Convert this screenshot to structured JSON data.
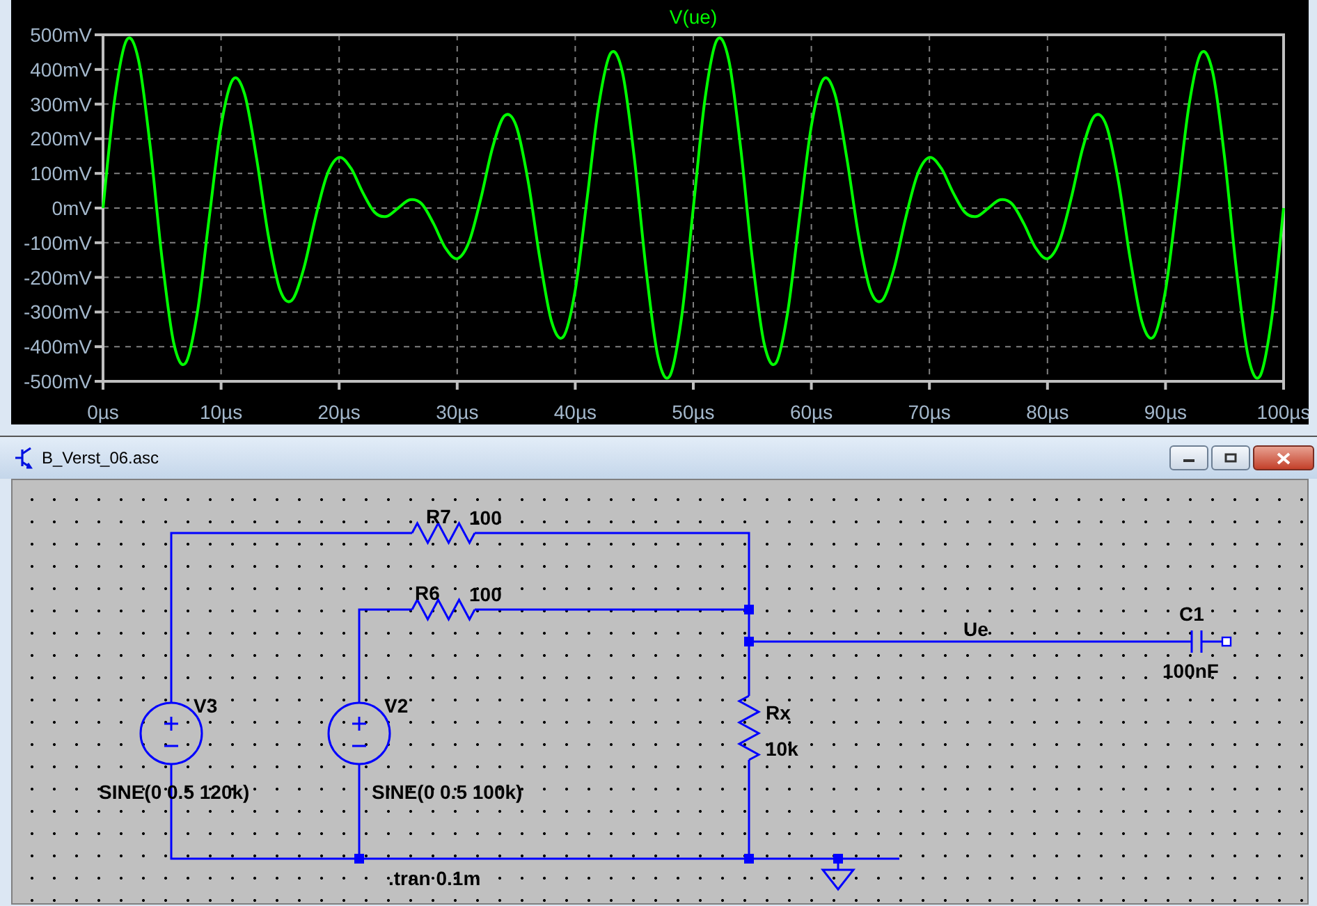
{
  "plot": {
    "chart_data": {
      "type": "line",
      "grid": true,
      "xlim": [
        0,
        100
      ],
      "ylim": [
        -500,
        500
      ],
      "xticks": [
        {
          "value": 0,
          "label": "0µs"
        },
        {
          "value": 10,
          "label": "10µs"
        },
        {
          "value": 20,
          "label": "20µs"
        },
        {
          "value": 30,
          "label": "30µs"
        },
        {
          "value": 40,
          "label": "40µs"
        },
        {
          "value": 50,
          "label": "50µs"
        },
        {
          "value": 60,
          "label": "60µs"
        },
        {
          "value": 70,
          "label": "70µs"
        },
        {
          "value": 80,
          "label": "80µs"
        },
        {
          "value": 90,
          "label": "90µs"
        },
        {
          "value": 100,
          "label": "100µs"
        }
      ],
      "yticks": [
        {
          "value": 500,
          "label": "500mV"
        },
        {
          "value": 400,
          "label": "400mV"
        },
        {
          "value": 300,
          "label": "300mV"
        },
        {
          "value": 200,
          "label": "200mV"
        },
        {
          "value": 100,
          "label": "100mV"
        },
        {
          "value": 0,
          "label": "0mV"
        },
        {
          "value": -100,
          "label": "-100mV"
        },
        {
          "value": -200,
          "label": "-200mV"
        },
        {
          "value": -300,
          "label": "-300mV"
        },
        {
          "value": -400,
          "label": "-400mV"
        },
        {
          "value": -500,
          "label": "-500mV"
        }
      ],
      "x": [
        0,
        1,
        2,
        3,
        4,
        5,
        6,
        7,
        8,
        9,
        10,
        11,
        12,
        13,
        14,
        15,
        16,
        17,
        18,
        19,
        20,
        21,
        22,
        23,
        24,
        25,
        26,
        27,
        28,
        29,
        30,
        31,
        32,
        33,
        34,
        35,
        36,
        37,
        38,
        39,
        40,
        41,
        42,
        43,
        44,
        45,
        46,
        47,
        48,
        49,
        50,
        51,
        52,
        53,
        54,
        55,
        56,
        57,
        58,
        59,
        60,
        61,
        62,
        63,
        64,
        65,
        66,
        67,
        68,
        69,
        70,
        71,
        72,
        73,
        74,
        75,
        76,
        77,
        78,
        79,
        80,
        81,
        82,
        83,
        84,
        85,
        86,
        87,
        88,
        89,
        90,
        91,
        92,
        93,
        94,
        95,
        96,
        97,
        98,
        99,
        100
      ],
      "series": [
        {
          "name": "V(ue)",
          "color": "#00ff00",
          "values": [
            0,
            317,
            485,
            428,
            177,
            -146,
            -391,
            -447,
            -299,
            -26,
            237,
            371,
            328,
            145,
            -79,
            -237,
            -266,
            -175,
            -27,
            98,
            146,
            115,
            45,
            -12,
            -24,
            0,
            24,
            12,
            -45,
            -115,
            -146,
            -98,
            27,
            175,
            266,
            237,
            79,
            -145,
            -328,
            -371,
            -237,
            26,
            299,
            447,
            391,
            146,
            -177,
            -428,
            -485,
            -317,
            0,
            317,
            485,
            428,
            177,
            -146,
            -391,
            -447,
            -299,
            -26,
            237,
            371,
            328,
            145,
            -79,
            -237,
            -266,
            -175,
            -27,
            98,
            146,
            115,
            45,
            -12,
            -24,
            0,
            24,
            12,
            -45,
            -115,
            -146,
            -98,
            27,
            175,
            266,
            237,
            79,
            -145,
            -328,
            -371,
            -237,
            26,
            299,
            447,
            391,
            146,
            -177,
            -428,
            -485,
            -317,
            0
          ]
        }
      ]
    }
  },
  "schematic_window": {
    "title": "B_Verst_06.asc",
    "components": [
      {
        "kind": "resistor",
        "name": "R7",
        "value": "100"
      },
      {
        "kind": "resistor",
        "name": "R6",
        "value": "100"
      },
      {
        "kind": "source",
        "name": "V3",
        "value": "SINE(0 0.5 120k)"
      },
      {
        "kind": "source",
        "name": "V2",
        "value": "SINE(0 0.5 100k)"
      },
      {
        "kind": "resistor",
        "name": "Rx",
        "value": "10k"
      },
      {
        "kind": "capacitor",
        "name": "C1",
        "value": "100nF"
      }
    ],
    "net_label": "Ue",
    "directive": ".tran 0.1m"
  }
}
